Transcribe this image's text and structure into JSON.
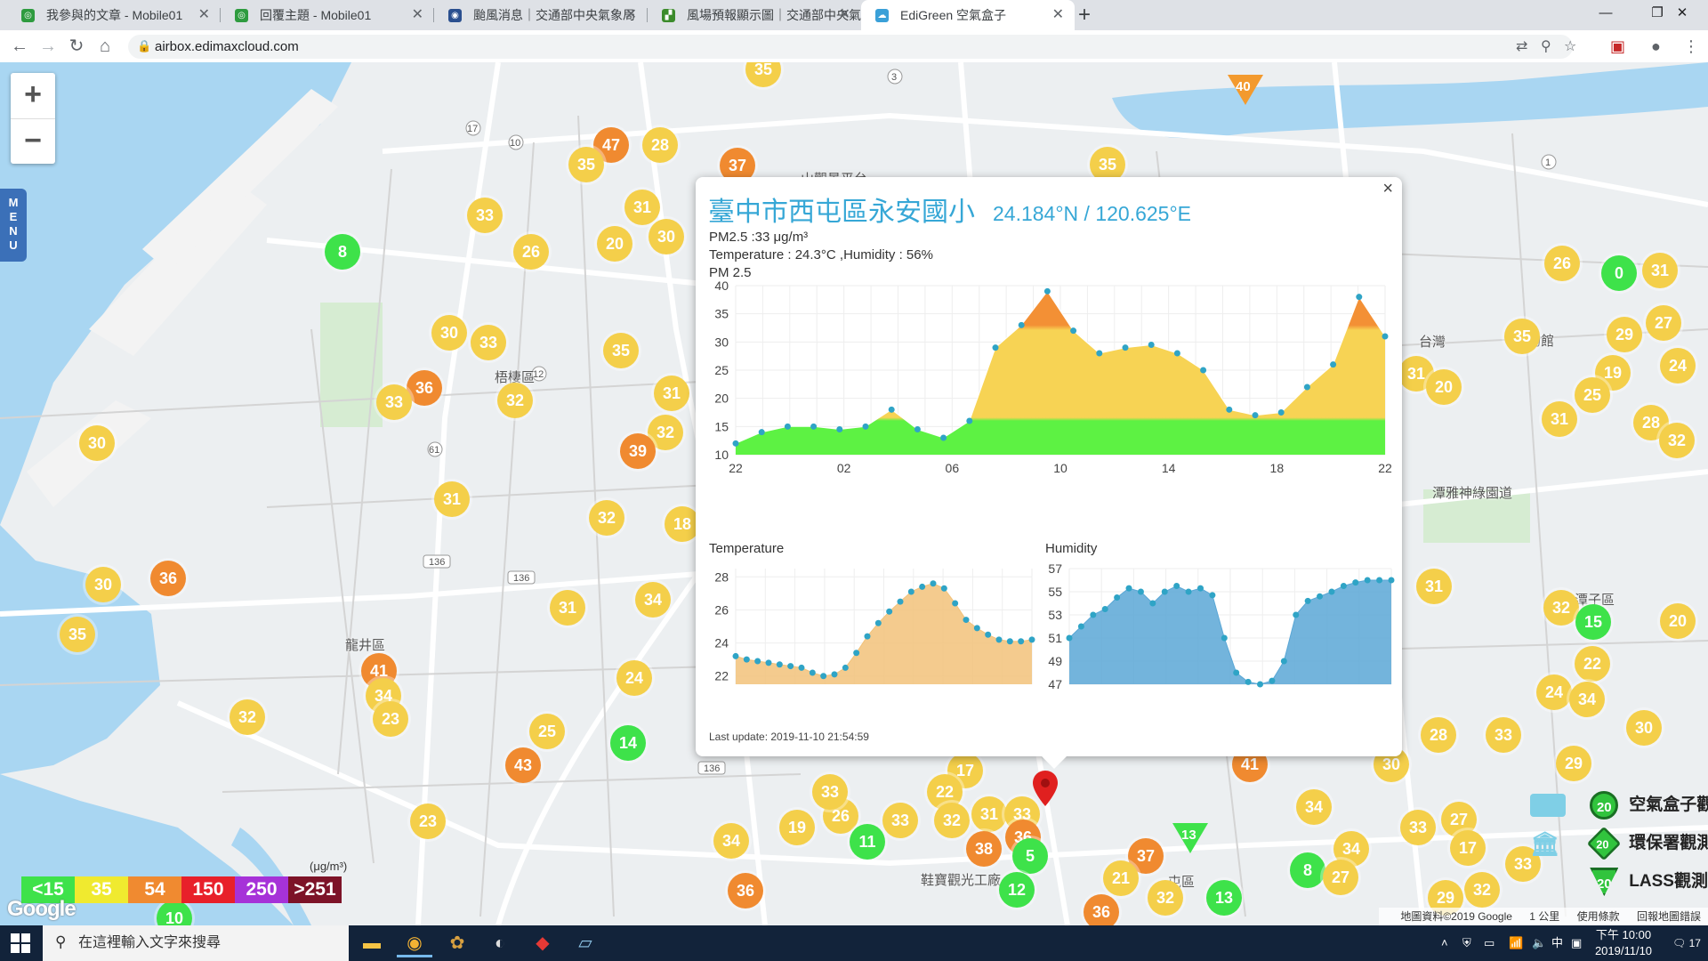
{
  "browser": {
    "tabs": [
      {
        "title": "我參與的文章 - Mobile01",
        "favicon": "mobile01-icon",
        "color": "#2e9b3f"
      },
      {
        "title": "回覆主題 - Mobile01",
        "favicon": "mobile01-icon",
        "color": "#2e9b3f"
      },
      {
        "title": "颱風消息｜交通部中央氣象局",
        "favicon": "cwb-eye-icon",
        "color": "#2a4f8f"
      },
      {
        "title": "風場預報顯示圖｜交通部中央氣象局",
        "favicon": "cwb-leaf-icon",
        "color": "#3c8b2c"
      },
      {
        "title": "EdiGreen 空氣盒子",
        "favicon": "edigreen-icon",
        "color": "#3aa0d8"
      }
    ],
    "url": "airbox.edimaxcloud.com"
  },
  "map": {
    "zoom_in": "+",
    "zoom_out": "−",
    "menu_label": "MENU",
    "markers": [
      {
        "v": "35",
        "c": "y",
        "x": 858,
        "y": 78
      },
      {
        "v": "47",
        "c": "o",
        "x": 687,
        "y": 163
      },
      {
        "v": "28",
        "c": "y",
        "x": 742,
        "y": 163
      },
      {
        "v": "35",
        "c": "y",
        "x": 659,
        "y": 185
      },
      {
        "v": "37",
        "c": "o",
        "x": 829,
        "y": 186
      },
      {
        "v": "35",
        "c": "y",
        "x": 1245,
        "y": 185
      },
      {
        "v": "31",
        "c": "y",
        "x": 722,
        "y": 233
      },
      {
        "v": "33",
        "c": "y",
        "x": 545,
        "y": 242
      },
      {
        "v": "8",
        "c": "g",
        "x": 385,
        "y": 283
      },
      {
        "v": "30",
        "c": "y",
        "x": 749,
        "y": 266
      },
      {
        "v": "20",
        "c": "y",
        "x": 691,
        "y": 274
      },
      {
        "v": "26",
        "c": "y",
        "x": 597,
        "y": 283
      },
      {
        "v": "30",
        "c": "y",
        "x": 505,
        "y": 374
      },
      {
        "v": "33",
        "c": "y",
        "x": 549,
        "y": 385
      },
      {
        "v": "35",
        "c": "y",
        "x": 698,
        "y": 394
      },
      {
        "v": "36",
        "c": "o",
        "x": 477,
        "y": 436
      },
      {
        "v": "33",
        "c": "y",
        "x": 443,
        "y": 452
      },
      {
        "v": "32",
        "c": "y",
        "x": 579,
        "y": 450
      },
      {
        "v": "31",
        "c": "y",
        "x": 755,
        "y": 442
      },
      {
        "v": "32",
        "c": "y",
        "x": 748,
        "y": 486
      },
      {
        "v": "39",
        "c": "o",
        "x": 717,
        "y": 507
      },
      {
        "v": "30",
        "c": "y",
        "x": 109,
        "y": 498
      },
      {
        "v": "31",
        "c": "y",
        "x": 508,
        "y": 561
      },
      {
        "v": "32",
        "c": "y",
        "x": 682,
        "y": 582
      },
      {
        "v": "18",
        "c": "y",
        "x": 767,
        "y": 589
      },
      {
        "v": "36",
        "c": "o",
        "x": 189,
        "y": 650
      },
      {
        "v": "30",
        "c": "y",
        "x": 116,
        "y": 657
      },
      {
        "v": "31",
        "c": "y",
        "x": 638,
        "y": 683
      },
      {
        "v": "34",
        "c": "y",
        "x": 734,
        "y": 674
      },
      {
        "v": "35",
        "c": "y",
        "x": 87,
        "y": 713
      },
      {
        "v": "41",
        "c": "o",
        "x": 426,
        "y": 754
      },
      {
        "v": "34",
        "c": "y",
        "x": 431,
        "y": 782
      },
      {
        "v": "23",
        "c": "y",
        "x": 439,
        "y": 808
      },
      {
        "v": "24",
        "c": "y",
        "x": 713,
        "y": 762
      },
      {
        "v": "32",
        "c": "y",
        "x": 278,
        "y": 806
      },
      {
        "v": "25",
        "c": "y",
        "x": 615,
        "y": 822
      },
      {
        "v": "14",
        "c": "g",
        "x": 706,
        "y": 835
      },
      {
        "v": "43",
        "c": "o",
        "x": 588,
        "y": 860
      },
      {
        "v": "23",
        "c": "y",
        "x": 481,
        "y": 923
      },
      {
        "v": "34",
        "c": "y",
        "x": 822,
        "y": 945
      },
      {
        "v": "19",
        "c": "y",
        "x": 896,
        "y": 930
      },
      {
        "v": "26",
        "c": "y",
        "x": 945,
        "y": 917
      },
      {
        "v": "11",
        "c": "g",
        "x": 975,
        "y": 946
      },
      {
        "v": "33",
        "c": "y",
        "x": 933,
        "y": 890
      },
      {
        "v": "33",
        "c": "y",
        "x": 1012,
        "y": 922
      },
      {
        "v": "17",
        "c": "y",
        "x": 1085,
        "y": 866
      },
      {
        "v": "22",
        "c": "y",
        "x": 1062,
        "y": 890
      },
      {
        "v": "32",
        "c": "y",
        "x": 1070,
        "y": 922
      },
      {
        "v": "31",
        "c": "y",
        "x": 1112,
        "y": 915
      },
      {
        "v": "33",
        "c": "y",
        "x": 1149,
        "y": 915
      },
      {
        "v": "36",
        "c": "o",
        "x": 1150,
        "y": 941
      },
      {
        "v": "38",
        "c": "o",
        "x": 1106,
        "y": 954
      },
      {
        "v": "5",
        "c": "g",
        "x": 1158,
        "y": 962
      },
      {
        "v": "36",
        "c": "o",
        "x": 838,
        "y": 1001
      },
      {
        "v": "12",
        "c": "g",
        "x": 1143,
        "y": 1000
      },
      {
        "v": "41",
        "c": "o",
        "x": 1405,
        "y": 859
      },
      {
        "v": "13",
        "c": "g",
        "x": 1376,
        "y": 1009
      },
      {
        "v": "37",
        "c": "o",
        "x": 1288,
        "y": 962
      },
      {
        "v": "21",
        "c": "y",
        "x": 1260,
        "y": 987
      },
      {
        "v": "32",
        "c": "y",
        "x": 1310,
        "y": 1009
      },
      {
        "v": "36",
        "c": "o",
        "x": 1238,
        "y": 1025
      },
      {
        "v": "8",
        "c": "g",
        "x": 1470,
        "y": 978
      },
      {
        "v": "34",
        "c": "y",
        "x": 1477,
        "y": 907
      },
      {
        "v": "34",
        "c": "y",
        "x": 1519,
        "y": 954
      },
      {
        "v": "27",
        "c": "y",
        "x": 1507,
        "y": 986
      },
      {
        "v": "26",
        "c": "y",
        "x": 1756,
        "y": 296
      },
      {
        "v": "0",
        "c": "g",
        "x": 1820,
        "y": 307
      },
      {
        "v": "31",
        "c": "y",
        "x": 1866,
        "y": 304
      },
      {
        "v": "27",
        "c": "y",
        "x": 1870,
        "y": 363
      },
      {
        "v": "35",
        "c": "y",
        "x": 1711,
        "y": 378
      },
      {
        "v": "29",
        "c": "y",
        "x": 1826,
        "y": 376
      },
      {
        "v": "24",
        "c": "y",
        "x": 1886,
        "y": 411
      },
      {
        "v": "19",
        "c": "y",
        "x": 1813,
        "y": 419
      },
      {
        "v": "31",
        "c": "y",
        "x": 1592,
        "y": 420
      },
      {
        "v": "20",
        "c": "y",
        "x": 1623,
        "y": 435
      },
      {
        "v": "25",
        "c": "y",
        "x": 1790,
        "y": 444
      },
      {
        "v": "31",
        "c": "y",
        "x": 1753,
        "y": 471
      },
      {
        "v": "28",
        "c": "y",
        "x": 1856,
        "y": 475
      },
      {
        "v": "32",
        "c": "y",
        "x": 1885,
        "y": 495
      },
      {
        "v": "31",
        "c": "y",
        "x": 1612,
        "y": 659
      },
      {
        "v": "32",
        "c": "y",
        "x": 1755,
        "y": 683
      },
      {
        "v": "15",
        "c": "g",
        "x": 1791,
        "y": 699
      },
      {
        "v": "20",
        "c": "y",
        "x": 1886,
        "y": 698
      },
      {
        "v": "22",
        "c": "y",
        "x": 1790,
        "y": 746
      },
      {
        "v": "24",
        "c": "y",
        "x": 1747,
        "y": 778
      },
      {
        "v": "34",
        "c": "y",
        "x": 1784,
        "y": 786
      },
      {
        "v": "30",
        "c": "y",
        "x": 1848,
        "y": 818
      },
      {
        "v": "28",
        "c": "y",
        "x": 1617,
        "y": 826
      },
      {
        "v": "33",
        "c": "y",
        "x": 1690,
        "y": 826
      },
      {
        "v": "29",
        "c": "y",
        "x": 1769,
        "y": 858
      },
      {
        "v": "30",
        "c": "y",
        "x": 1564,
        "y": 859
      },
      {
        "v": "33",
        "c": "y",
        "x": 1594,
        "y": 930
      },
      {
        "v": "27",
        "c": "y",
        "x": 1640,
        "y": 921
      },
      {
        "v": "17",
        "c": "y",
        "x": 1650,
        "y": 953
      },
      {
        "v": "33",
        "c": "y",
        "x": 1712,
        "y": 971
      },
      {
        "v": "32",
        "c": "y",
        "x": 1666,
        "y": 1000
      },
      {
        "v": "29",
        "c": "y",
        "x": 1625,
        "y": 1009
      },
      {
        "v": "10",
        "c": "g",
        "x": 196,
        "y": 1032
      }
    ],
    "region_labels": [
      {
        "text": "梧棲區",
        "x": 556,
        "y": 413
      },
      {
        "text": "龍井區",
        "x": 388,
        "y": 714
      },
      {
        "text": "山觀景平台",
        "x": 900,
        "y": 190
      },
      {
        "text": "潭雅神綠園道",
        "x": 1610,
        "y": 543
      },
      {
        "text": "潭子區",
        "x": 1770,
        "y": 663
      },
      {
        "text": "台灣",
        "x": 1595,
        "y": 373
      },
      {
        "text": "博物館",
        "x": 1702,
        "y": 372
      },
      {
        "text": "鞋寶觀光工廠",
        "x": 1035,
        "y": 978
      },
      {
        "text": "屯區",
        "x": 1313,
        "y": 980
      }
    ],
    "road_shields": [
      "17",
      "10",
      "136",
      "136",
      "61",
      "12",
      "61"
    ],
    "warning_badge": "40",
    "warning_badge_2": "13",
    "legend": {
      "unit": "(μg/m³)",
      "items": [
        {
          "label": "<15",
          "color": "#3ee24a"
        },
        {
          "label": "35",
          "color": "#f0ea2f"
        },
        {
          "label": "54",
          "color": "#f08a30"
        },
        {
          "label": "150",
          "color": "#e8202a"
        },
        {
          "label": "250",
          "color": "#a632d8"
        },
        {
          "label": ">251",
          "color": "#7d1328"
        }
      ]
    },
    "google_logo": "Google",
    "station_legend": [
      {
        "value": "20",
        "label": "空氣盒子觀測點"
      },
      {
        "value": "20",
        "label": "環保署觀測站"
      },
      {
        "value": "20",
        "label": "LASS觀測站"
      }
    ],
    "footer": {
      "data": "地圖資料©2019 Google",
      "scale": "1 公里",
      "terms": "使用條款",
      "report": "回報地圖錯誤"
    }
  },
  "popup": {
    "title": "臺中市西屯區永安國小",
    "coords": "24.184°N / 120.625°E",
    "pm_line": "PM2.5 :33 μg/m³",
    "temp_line": "Temperature : 24.3°C ,Humidity : 56%",
    "pm_chart_title": "PM 2.5",
    "temp_chart_title": "Temperature",
    "humidity_chart_title": "Humidity",
    "last_update": "Last update: 2019-11-10 21:54:59",
    "close": "×"
  },
  "chart_data": [
    {
      "type": "area",
      "title": "PM 2.5",
      "x_ticks": [
        "22",
        "02",
        "06",
        "10",
        "14",
        "18",
        "22"
      ],
      "ylim": [
        10,
        40
      ],
      "y_ticks": [
        10,
        15,
        20,
        25,
        30,
        35,
        40
      ],
      "values": [
        12,
        14,
        15,
        15,
        14.5,
        15,
        18,
        14.5,
        13,
        16,
        29,
        33,
        39,
        32,
        28,
        29,
        29.5,
        28,
        25,
        18,
        17,
        17.5,
        22,
        26,
        38,
        31
      ],
      "thresholds": {
        "green_below": 16,
        "orange_above": 33
      },
      "colors": {
        "low": "#5df243",
        "mid": "#f7d354",
        "high": "#f39035"
      }
    },
    {
      "type": "area",
      "title": "Temperature",
      "ylim": [
        21.5,
        28.5
      ],
      "y_ticks": [
        22,
        24,
        26,
        28
      ],
      "values": [
        23.2,
        23.0,
        22.9,
        22.8,
        22.7,
        22.6,
        22.5,
        22.2,
        22.0,
        22.1,
        22.5,
        23.4,
        24.4,
        25.2,
        25.9,
        26.5,
        27.1,
        27.4,
        27.6,
        27.3,
        26.4,
        25.4,
        24.9,
        24.5,
        24.2,
        24.1,
        24.1,
        24.2
      ],
      "colors": {
        "fill": "#f2c27a",
        "line": "#f2c27a",
        "dot": "#2fa4c6"
      }
    },
    {
      "type": "area",
      "title": "Humidity",
      "ylim": [
        47,
        57
      ],
      "y_ticks": [
        47,
        49,
        51,
        53,
        55,
        57
      ],
      "values": [
        51,
        52,
        53,
        53.5,
        54.5,
        55.3,
        55,
        54,
        55,
        55.5,
        55,
        55.3,
        54.7,
        51,
        48,
        47.2,
        47,
        47.3,
        49,
        53,
        54.2,
        54.6,
        55,
        55.5,
        55.8,
        56,
        56,
        56
      ],
      "colors": {
        "fill": "#5aa7d6",
        "line": "#5aa7d6",
        "dot": "#2fa4c6"
      }
    }
  ],
  "taskbar": {
    "search_placeholder": "在這裡輸入文字來搜尋",
    "tray_input": "中",
    "time": "下午 10:00",
    "date": "2019/11/10",
    "notifications": "17"
  }
}
